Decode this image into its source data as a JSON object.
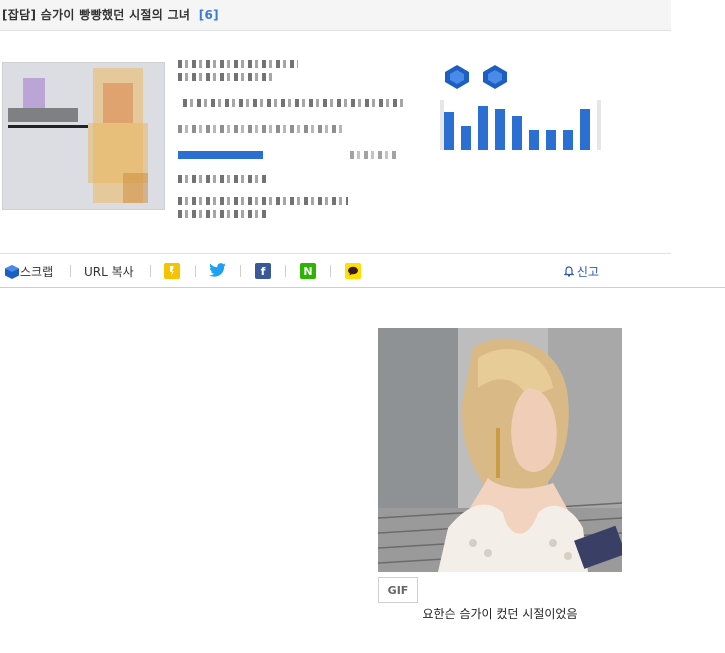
{
  "post": {
    "category": "[잡담]",
    "title": "슴가이 빵빵했던 시절의 그녀",
    "comment_count": "[6]"
  },
  "actions": {
    "scrap": "스크랩",
    "url_copy": "URL 복사",
    "report": "신고"
  },
  "share_icons": [
    {
      "name": "kakaostory",
      "color": "#f5c300"
    },
    {
      "name": "twitter",
      "color": "#1da1f2"
    },
    {
      "name": "facebook",
      "color": "#3b5998"
    },
    {
      "name": "naver",
      "color": "#2db400"
    },
    {
      "name": "kakaotalk",
      "color": "#ffe000"
    }
  ],
  "stats_bars": [
    0.75,
    0.48,
    0.88,
    0.82,
    0.68,
    0.4,
    0.4,
    0.4,
    0.82
  ],
  "media": {
    "gif_label": "GIF",
    "caption": "요한슨 슴가이 컸던 시절이었음"
  },
  "colors": {
    "accent": "#2b6fd3",
    "link": "#3b7ad6"
  }
}
